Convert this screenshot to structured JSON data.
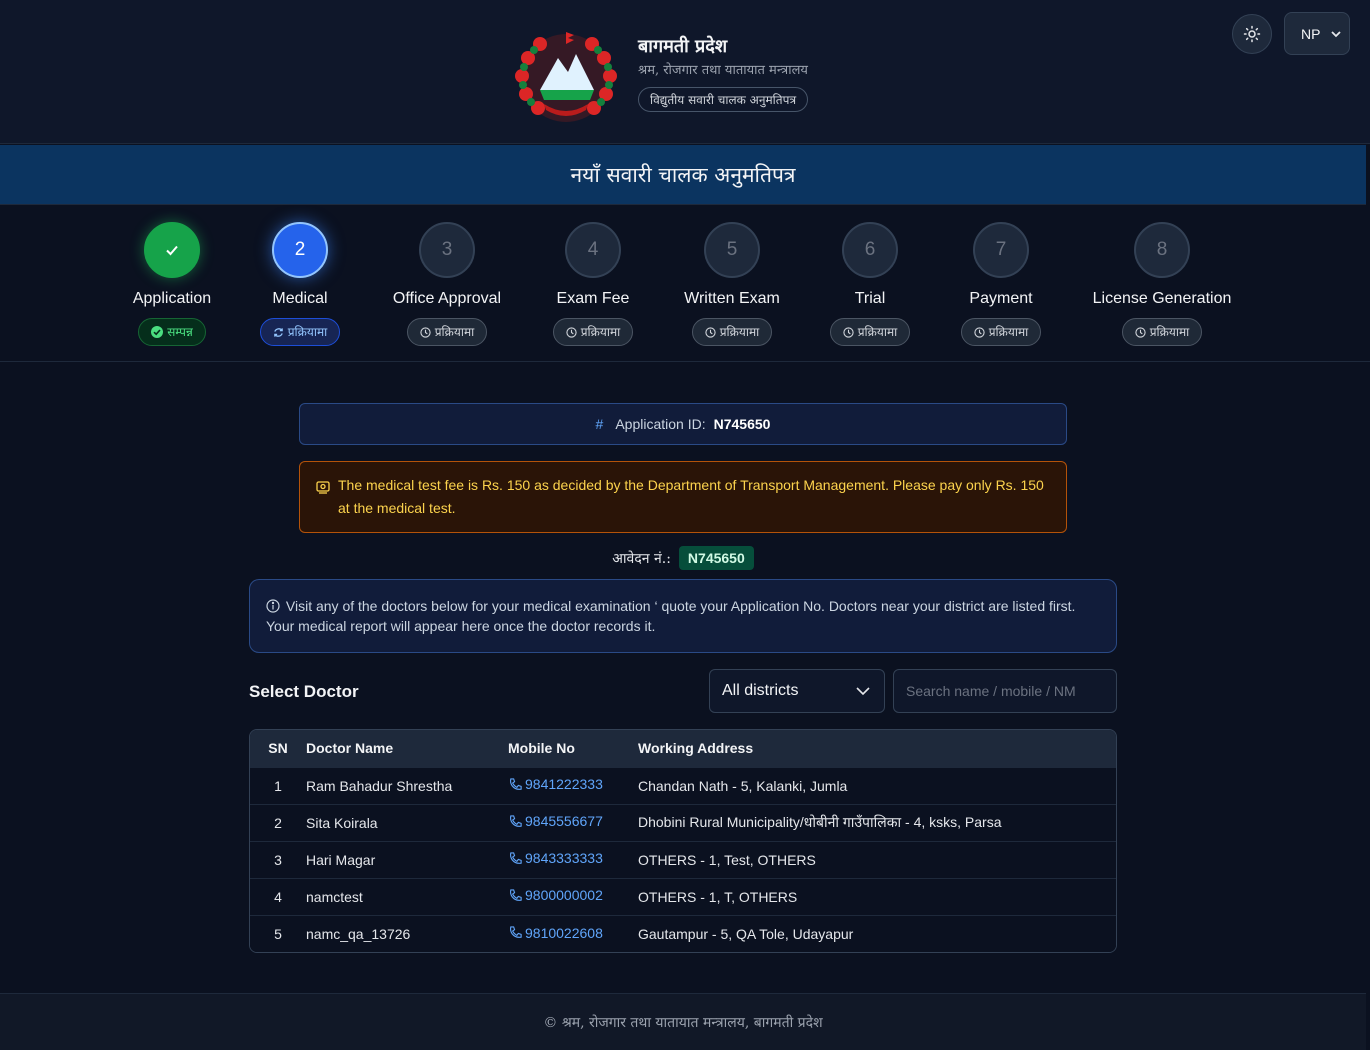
{
  "header": {
    "title": "बागमती प्रदेश",
    "subtitle": "श्रम, रोजगार तथा यातायात मन्त्रालय",
    "pill": "विद्युतीय सवारी चालक अनुमतिपत्र",
    "language": "NP"
  },
  "banner": {
    "title": "नयाँ सवारी चालक अनुमतिपत्र"
  },
  "steps": [
    {
      "number": "✓",
      "label": "Application",
      "status": "सम्पन्न",
      "state": "done"
    },
    {
      "number": "2",
      "label": "Medical",
      "status": "प्रक्रियामा",
      "state": "current"
    },
    {
      "number": "3",
      "label": "Office Approval",
      "status": "प्रक्रियामा",
      "state": "pending"
    },
    {
      "number": "4",
      "label": "Exam Fee",
      "status": "प्रक्रियामा",
      "state": "pending"
    },
    {
      "number": "5",
      "label": "Written Exam",
      "status": "प्रक्रियामा",
      "state": "pending"
    },
    {
      "number": "6",
      "label": "Trial",
      "status": "प्रक्रियामा",
      "state": "pending"
    },
    {
      "number": "7",
      "label": "Payment",
      "status": "प्रक्रियामा",
      "state": "pending"
    },
    {
      "number": "8",
      "label": "License Generation",
      "status": "प्रक्रियामा",
      "state": "pending"
    }
  ],
  "application": {
    "hash": "#",
    "id_label": "Application ID:",
    "id_value": "N745650"
  },
  "fee_alert": {
    "text": "The medical test fee is Rs. 150 as decided by the Department of Transport Management. Please pay only Rs. 150 at the medical test."
  },
  "avedan": {
    "label": "आवेदन नं.:",
    "value": "N745650"
  },
  "info": {
    "text": "Visit any of the doctors below for your medical examination ‘ quote your Application No. Doctors near your district are listed first. Your medical report will appear here once the doctor records it."
  },
  "doctor_section": {
    "title": "Select Doctor",
    "district_selected": "All districts",
    "search_placeholder": "Search name / mobile / NM"
  },
  "table": {
    "headers": {
      "sn": "SN",
      "name": "Doctor Name",
      "mobile": "Mobile No",
      "address": "Working Address"
    },
    "rows": [
      {
        "sn": "1",
        "name": "Ram Bahadur Shrestha",
        "mobile": "9841222333",
        "address": "Chandan Nath - 5, Kalanki, Jumla"
      },
      {
        "sn": "2",
        "name": "Sita Koirala",
        "mobile": "9845556677",
        "address": "Dhobini Rural Municipality/धोबीनी गाउँपालिका - 4, ksks, Parsa"
      },
      {
        "sn": "3",
        "name": "Hari Magar",
        "mobile": "9843333333",
        "address": "OTHERS - 1, Test, OTHERS"
      },
      {
        "sn": "4",
        "name": "namctest",
        "mobile": "9800000002",
        "address": "OTHERS - 1, T, OTHERS"
      },
      {
        "sn": "5",
        "name": "namc_qa_13726",
        "mobile": "9810022608",
        "address": "Gautampur - 5, QA Tole, Udayapur"
      }
    ]
  },
  "footer": {
    "text": "© श्रम, रोजगार तथा यातायात मन्त्रालय, बागमती प्रदेश"
  },
  "colors": {
    "success": "#16a34a",
    "primary": "#2563eb",
    "warning": "#fcd34d",
    "link": "#60a5fa"
  },
  "icons": {
    "theme": "sun-icon",
    "done": "check-circle-icon",
    "current": "refresh-icon",
    "pending": "clock-icon",
    "phone": "phone-icon",
    "info": "info-icon",
    "fee": "receipt-icon"
  }
}
